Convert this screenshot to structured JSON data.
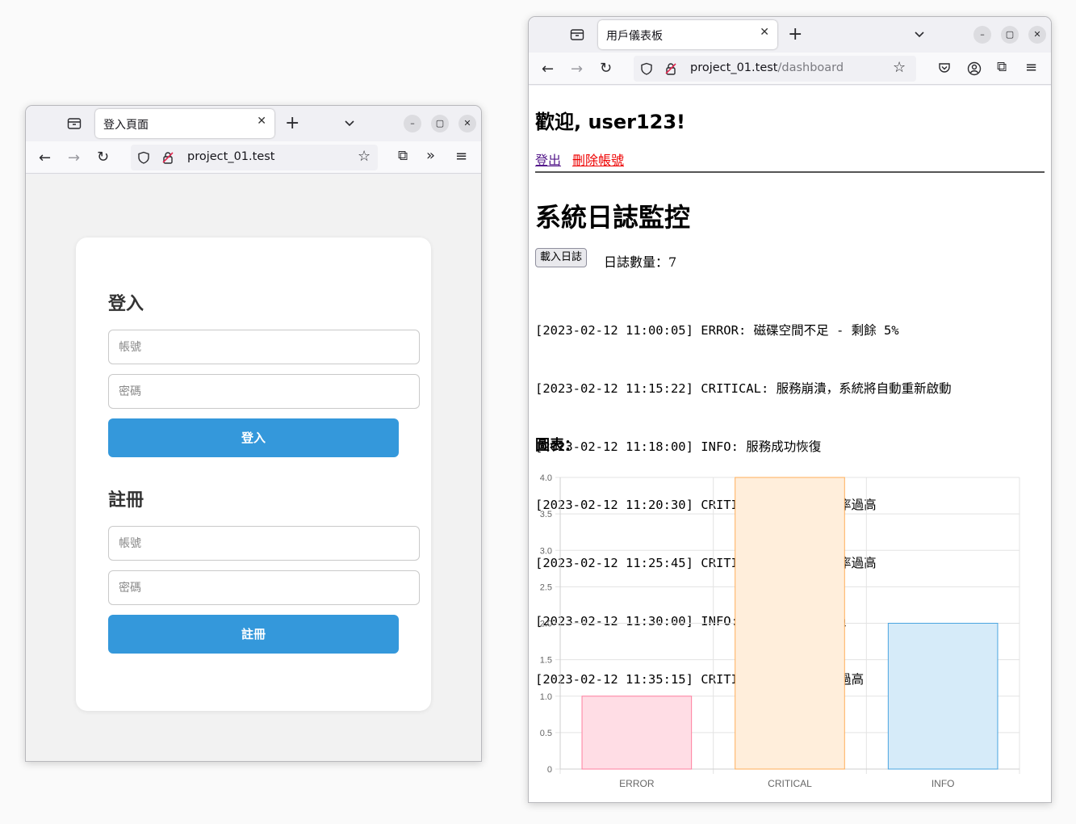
{
  "login_window": {
    "tab_title": "登入頁面",
    "url": "project_01.test",
    "login": {
      "heading": "登入",
      "username_placeholder": "帳號",
      "password_placeholder": "密碼",
      "button": "登入"
    },
    "register": {
      "heading": "註冊",
      "username_placeholder": "帳號",
      "password_placeholder": "密碼",
      "button": "註冊"
    }
  },
  "dashboard_window": {
    "tab_title": "用戶儀表板",
    "url_host": "project_01.test",
    "url_path": "/dashboard",
    "welcome": "歡迎, user123!",
    "links": {
      "logout": "登出",
      "delete_account": "刪除帳號"
    },
    "section_title": "系統日誌監控",
    "load_button": "載入日誌",
    "log_count": "日誌數量：7",
    "logs": [
      "[2023-02-12 11:00:05] ERROR: 磁碟空間不足 - 剩餘 5%",
      "[2023-02-12 11:15:22] CRITICAL: 服務崩潰，系統將自動重新啟動",
      "[2023-02-12 11:18:00] INFO: 服務成功恢復",
      "[2023-02-12 11:20:30] CRITICAL: 記憶體使用率過高",
      "[2023-02-12 11:25:45] CRITICAL: 記憶體使用率過高",
      "[2023-02-12 11:30:00] INFO: 系統健康檢查通過",
      "[2023-02-12 11:35:15] CRITICAL: 伺服器溫度過高"
    ],
    "chart_heading": "圖表："
  },
  "colors": {
    "primary_button": "#3498db",
    "logout_link": "#551a8b",
    "delete_link": "#ee0000"
  },
  "chart_data": {
    "type": "bar",
    "categories": [
      "ERROR",
      "CRITICAL",
      "INFO"
    ],
    "values": [
      1,
      4,
      2
    ],
    "ylim": [
      0,
      4
    ],
    "yticks": [
      "0",
      "0.5",
      "1.0",
      "1.5",
      "2.0",
      "2.5",
      "3.0",
      "3.5",
      "4.0"
    ],
    "grid": true,
    "bar_fill_colors": [
      "#ffdde5",
      "#ffeedb",
      "#d6ebf9"
    ],
    "bar_border_colors": [
      "#ff7f9f",
      "#ffae5a",
      "#4aa4e0"
    ]
  }
}
